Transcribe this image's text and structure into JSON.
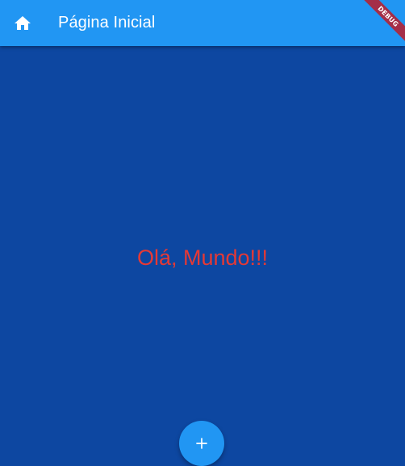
{
  "appbar": {
    "title": "Página Inicial",
    "leading_icon": "home-icon",
    "color": "#2196f3"
  },
  "body": {
    "background": "#0d47a1",
    "greeting": "Olá, Mundo!!!",
    "greeting_color": "#e53935"
  },
  "fab": {
    "icon": "add-icon",
    "color": "#2196f3"
  },
  "debug_banner": {
    "label": "DEBUG",
    "color": "#a42e48"
  }
}
